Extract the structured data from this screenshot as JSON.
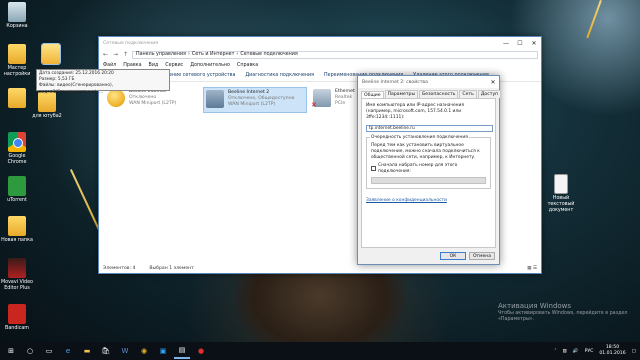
{
  "desktop": {
    "icons": [
      {
        "label": "Корзина",
        "icon": "recycle-bin-icon"
      },
      {
        "label": "Мастер настройки",
        "icon": "folder-icon"
      },
      {
        "label": "",
        "icon": "folder-icon"
      },
      {
        "label": "для ютуба2",
        "icon": "folder-icon"
      },
      {
        "label": "Google Chrome",
        "icon": "chrome-icon"
      },
      {
        "label": "uTorrent",
        "icon": "utorrent-icon"
      },
      {
        "label": "Новая папка",
        "icon": "folder-icon"
      },
      {
        "label": "Movavi Video Editor Plus",
        "icon": "movavi-icon"
      },
      {
        "label": "Bandicam",
        "icon": "bandicam-icon"
      },
      {
        "label": "Новый текстовый документ",
        "icon": "text-document-icon"
      }
    ],
    "tooltip": {
      "line1": "Дата создания: 25.12.2016 20:20",
      "line2": "Размер: 5,53 ГБ",
      "line3": "Файлы: видео(Сгенерированно), видео3(Сгенерированно), ..."
    },
    "watermark": {
      "title": "Активация Windows",
      "subtitle": "Чтобы активировать Windows, перейдите в раздел «Параметры»."
    }
  },
  "explorer": {
    "title": "Сетевые подключения",
    "window_controls": [
      "—",
      "☐",
      "✕"
    ],
    "address": {
      "segments": [
        "Панель управления",
        "Сеть и Интернет",
        "Сетевые подключения"
      ],
      "separator": "›"
    },
    "menu": [
      "Файл",
      "Правка",
      "Вид",
      "Сервис",
      "Дополнительно",
      "Справка"
    ],
    "commands": [
      "Упорядочить ▾",
      "Отключение сетевого устройства",
      "Диагностика подключения",
      "Переименование подключения",
      "Удаление этого подключения"
    ],
    "back_panel_label": "Панель",
    "connections": [
      {
        "name": "Beeline Internet",
        "status": "Отключено",
        "device": "WAN Miniport (L2TP)",
        "icon": "globe-connection-icon"
      },
      {
        "name": "Beeline Internet 2",
        "status": "Отключено, Общедоступна",
        "device": "WAN Miniport (L2TP)",
        "icon": "network-connection-icon"
      },
      {
        "name": "Ethernet",
        "status": "Сетевой кабель не подключен",
        "device": "Realtek PCIe",
        "icon": "ethernet-icon"
      }
    ],
    "status": {
      "items": "Элементов: 4",
      "selected": "Выбран 1 элемент"
    }
  },
  "dialog": {
    "title": "Beeline Internet 2: свойства",
    "tabs": [
      "Общие",
      "Параметры",
      "Безопасность",
      "Сеть",
      "Доступ"
    ],
    "host_label": "Имя компьютера или IP-адрес назначения (например, microsoft.com, 157.54.0.1 или 3ffe:1234::1111):",
    "host_value": "tp.internet.beeline.ru",
    "group_title": "Очередность установления подключения",
    "group_text": "Перед тем как установить виртуальное подключение, можно сначала подключиться к общественной сети, например, к Интернету.",
    "checkbox_label": "Сначала набрать номер для этого подключения:",
    "privacy_link": "Заявление о конфиденциальности",
    "ok": "ОК",
    "cancel": "Отмена"
  },
  "taskbar": {
    "tray_lang": "РУС",
    "time": "18:50",
    "date": "01.01.2016"
  }
}
